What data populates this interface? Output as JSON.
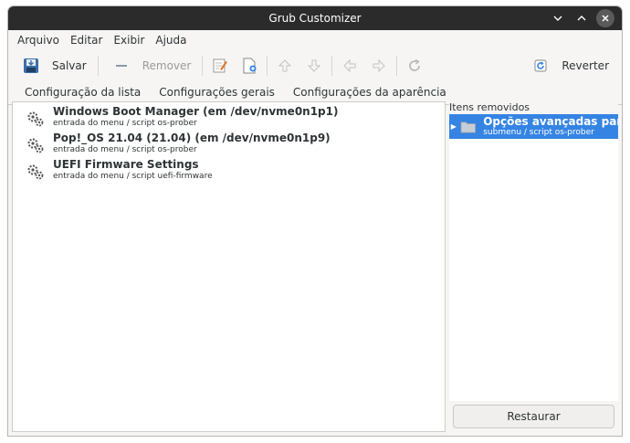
{
  "window": {
    "title": "Grub Customizer"
  },
  "menu": [
    "Arquivo",
    "Editar",
    "Exibir",
    "Ajuda"
  ],
  "toolbar": {
    "save_label": "Salvar",
    "remove_label": "Remover",
    "revert_label": "Reverter"
  },
  "tabs": [
    "Configuração da lista",
    "Configurações gerais",
    "Configurações da aparência"
  ],
  "entries": [
    {
      "name": "Windows Boot Manager (em /dev/nvme0n1p1)",
      "sub": "entrada do menu / script os-prober"
    },
    {
      "name": "Pop!_OS 21.04 (21.04) (em /dev/nvme0n1p9)",
      "sub": "entrada do menu / script os-prober"
    },
    {
      "name": "UEFI Firmware Settings",
      "sub": "entrada do menu / script uefi-firmware"
    }
  ],
  "removed": {
    "header": "Itens removidos",
    "items": [
      {
        "name": "Opções avançadas para P...",
        "sub": "submenu / script os-prober"
      }
    ],
    "restore_label": "Restaurar"
  },
  "colors": {
    "accent": "#3584e4",
    "titlebar": "#2b2b2b"
  }
}
